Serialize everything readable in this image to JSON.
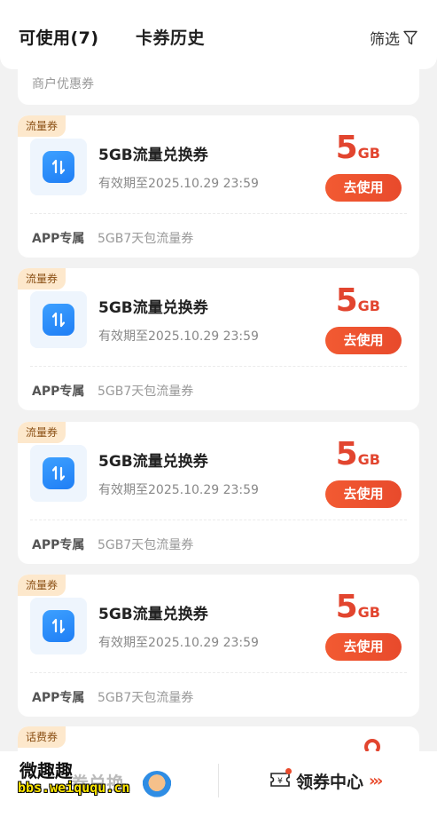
{
  "header": {
    "tab_available": "可使用(7)",
    "tab_history": "卡券历史",
    "filter_label": "筛选"
  },
  "merchant_section": {
    "label": "商户优惠券"
  },
  "coupons": [
    {
      "tag": "流量券",
      "title": "5GB流量兑换券",
      "expiry": "有效期至2025.10.29 23:59",
      "amount": "5",
      "unit": "GB",
      "button": "去使用",
      "footer_label": "APP专属",
      "footer_desc": "5GB7天包流量券"
    },
    {
      "tag": "流量券",
      "title": "5GB流量兑换券",
      "expiry": "有效期至2025.10.29 23:59",
      "amount": "5",
      "unit": "GB",
      "button": "去使用",
      "footer_label": "APP专属",
      "footer_desc": "5GB7天包流量券"
    },
    {
      "tag": "流量券",
      "title": "5GB流量兑换券",
      "expiry": "有效期至2025.10.29 23:59",
      "amount": "5",
      "unit": "GB",
      "button": "去使用",
      "footer_label": "APP专属",
      "footer_desc": "5GB7天包流量券"
    },
    {
      "tag": "流量券",
      "title": "5GB流量兑换券",
      "expiry": "有效期至2025.10.29 23:59",
      "amount": "5",
      "unit": "GB",
      "button": "去使用",
      "footer_label": "APP专属",
      "footer_desc": "5GB7天包流量券"
    }
  ],
  "partial_coupon": {
    "tag": "话费券"
  },
  "bottom_bar": {
    "exchange_label": "券兑换",
    "coupon_center_label": "领券中心",
    "watermark_text": "微趣趣",
    "watermark_url": "bbs.weiququ.cn"
  },
  "colors": {
    "accent": "#e84a2c",
    "tag_bg": "#fde8cc",
    "icon_blue": "#1f7ef5"
  }
}
